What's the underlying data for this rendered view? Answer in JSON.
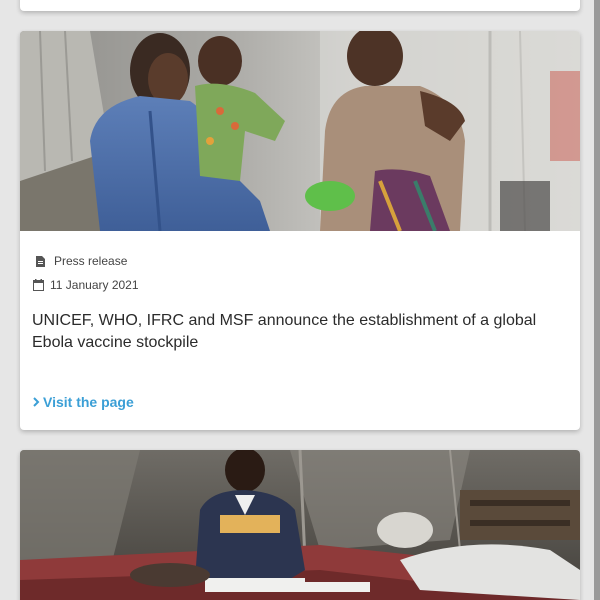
{
  "cards": [
    {
      "image_alt": "Health worker in blue protective gown holding a baby next to a woman in a tent",
      "type_label": "Press release",
      "type_icon": "document-icon",
      "date": "11 January 2021",
      "date_icon": "calendar-icon",
      "headline": "UNICEF, WHO, IFRC and MSF announce the establishment of a global Ebola vaccine stockpile",
      "link_label": "Visit the page",
      "link_icon": "chevron-right-icon"
    },
    {
      "image_alt": "Boy sitting on a mattress reading books inside a tent"
    }
  ],
  "colors": {
    "background": "#e6e6e6",
    "card": "#ffffff",
    "link": "#3b9fd6",
    "text": "#2b2b2b",
    "meta_text": "#444444"
  }
}
